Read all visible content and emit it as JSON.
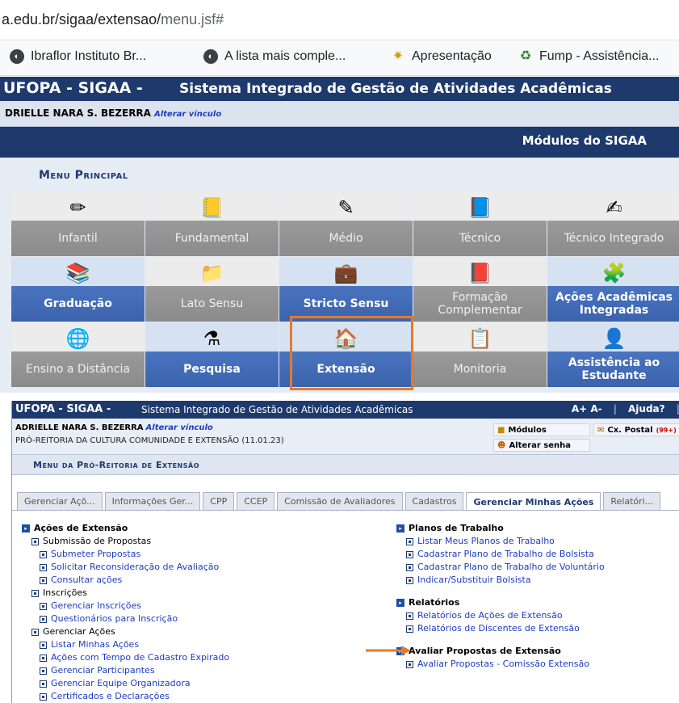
{
  "browser": {
    "url_prefix": "a.edu.br/sigaa/extensao/",
    "url_suffix": "menu.jsf#",
    "bookmarks": [
      {
        "label": "Ibraflor Instituto Br...",
        "icon": "globe-icon"
      },
      {
        "label": "A lista mais comple...",
        "icon": "globe-icon"
      },
      {
        "label": "Apresentação",
        "icon": "star-icon"
      },
      {
        "label": "Fump - Assistência...",
        "icon": "recycle-icon"
      }
    ]
  },
  "top": {
    "brand": "UFOPA - SIGAA -",
    "system_name": "Sistema Integrado de Gestão de Atividades Acadêmicas",
    "user_name": "DRIELLE NARA S. BEZERRA",
    "change_link": "Alterar vínculo",
    "modules_title": "Módulos do SIGAA",
    "menu_heading": "Menu Principal",
    "tiles": [
      {
        "label": "Infantil",
        "icon": "pencil-cup-icon",
        "glyph": "✏",
        "style": "gray"
      },
      {
        "label": "Fundamental",
        "icon": "notebook-icon",
        "glyph": "📒",
        "style": "gray"
      },
      {
        "label": "Médio",
        "icon": "pencil-icon",
        "glyph": "✎",
        "style": "gray"
      },
      {
        "label": "Técnico",
        "icon": "book-icon",
        "glyph": "📘",
        "style": "gray"
      },
      {
        "label": "Técnico Integrado",
        "icon": "draw-icon",
        "glyph": "✍",
        "style": "gray"
      },
      {
        "label": "Graduação",
        "icon": "books-icon",
        "glyph": "📚",
        "style": "blue"
      },
      {
        "label": "Lato Sensu",
        "icon": "folder-icon",
        "glyph": "📁",
        "style": "gray"
      },
      {
        "label": "Stricto Sensu",
        "icon": "briefcase-icon",
        "glyph": "💼",
        "style": "blue"
      },
      {
        "label": "Formação Complementar",
        "icon": "red-book-icon",
        "glyph": "📕",
        "style": "gray"
      },
      {
        "label": "Ações Acadêmicas Integradas",
        "icon": "puzzle-icon",
        "glyph": "🧩",
        "style": "blue"
      },
      {
        "label": "Ensino a Distância",
        "icon": "globe-icon",
        "glyph": "🌐",
        "style": "gray"
      },
      {
        "label": "Pesquisa",
        "icon": "flask-icon",
        "glyph": "⚗",
        "style": "blue"
      },
      {
        "label": "Extensão",
        "icon": "house-icon",
        "glyph": "🏠",
        "style": "blue"
      },
      {
        "label": "Monitoria",
        "icon": "easel-icon",
        "glyph": "📋",
        "style": "gray"
      },
      {
        "label": "Assistência ao Estudante",
        "icon": "user-icon",
        "glyph": "👤",
        "style": "blue"
      }
    ]
  },
  "bottom": {
    "brand": "UFOPA - SIGAA -",
    "system_name": "Sistema Integrado de Gestão de Atividades Acadêmicas",
    "font_controls": "A+ A-",
    "help": "Ajuda?",
    "user_name": "ADRIELLE NARA S. BEZERRA",
    "change_link": "Alterar vínculo",
    "unit": "PRÓ-REITORIA DA CULTURA COMUNIDADE E EXTENSÃO (11.01.23)",
    "modules_btn": "Módulos",
    "postal_btn": "Cx. Postal",
    "postal_count": "(99+)",
    "password_btn": "Alterar senha",
    "menu_heading": "Menu da Pró-Reitoria de Extensão",
    "tabs": [
      {
        "label": "Gerenciar Açõ...",
        "active": false
      },
      {
        "label": "Informações Ger...",
        "active": false
      },
      {
        "label": "CPP",
        "active": false
      },
      {
        "label": "CCEP",
        "active": false
      },
      {
        "label": "Comissão de Avaliadores",
        "active": false
      },
      {
        "label": "Cadastros",
        "active": false
      },
      {
        "label": "Gerenciar Minhas Ações",
        "active": true
      },
      {
        "label": "Relatóri...",
        "active": false
      }
    ],
    "left": {
      "title": "Ações de Extensão",
      "groups": [
        {
          "label": "Submissão de Propostas",
          "items": [
            "Submeter Propostas",
            "Solicitar Reconsideração de Avaliação",
            "Consultar ações"
          ]
        },
        {
          "label": "Inscrições",
          "items": [
            "Gerenciar Inscrições",
            "Questionários para Inscrição"
          ]
        },
        {
          "label": "Gerenciar Ações",
          "items": [
            "Listar Minhas Ações",
            "Ações com Tempo de Cadastro Expirado",
            "Gerenciar Participantes",
            "Gerenciar Equipe Organizadora",
            "Certificados e Declarações"
          ]
        }
      ]
    },
    "right": {
      "planos_title": "Planos de Trabalho",
      "planos": [
        "Listar Meus Planos de Trabalho",
        "Cadastrar Plano de Trabalho de Bolsista",
        "Cadastrar Plano de Trabalho de Voluntário",
        "Indicar/Substituir Bolsista"
      ],
      "relatorios_title": "Relatórios",
      "relatorios": [
        "Relatórios de Ações de Extensão",
        "Relatórios de Discentes de Extensão"
      ],
      "avaliar_title": "Avaliar Propostas de Extensão",
      "avaliar": [
        "Avaliar Propostas - Comissão Extensão"
      ]
    }
  },
  "colors": {
    "header_navy": "#1e3a6d",
    "tile_blue": "#4a74c0",
    "tile_gray": "#9a9a9a",
    "highlight_orange": "#e07a2f",
    "link_blue": "#1c3cc0"
  }
}
